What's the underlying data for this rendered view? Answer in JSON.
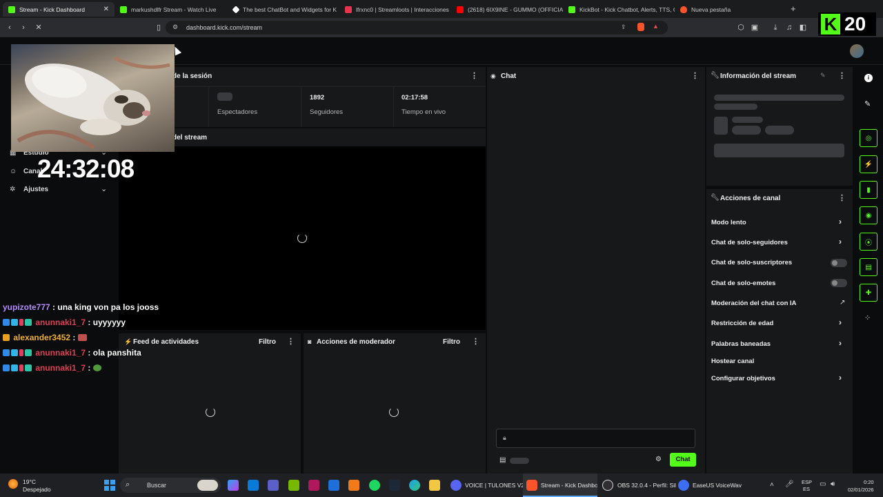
{
  "browser": {
    "tabs": [
      {
        "title": "Stream - Kick Dashboard",
        "color": "#53fc18"
      },
      {
        "title": "markushdlfr Stream - Watch Live",
        "color": "#53fc18"
      },
      {
        "title": "The best ChatBot and Widgets for K",
        "color": "#ffffff"
      },
      {
        "title": "lfrxnc0 | Streamloots | Interacciones",
        "color": "#e8344e"
      },
      {
        "title": "(2618) 6IX9INE - GUMMO (OFFICIAL",
        "color": "#ff0000"
      },
      {
        "title": "KickBot - Kick Chatbot, Alerts, TTS, O",
        "color": "#53fc18"
      },
      {
        "title": "Nueva pestaña",
        "color": "#fb542b"
      }
    ],
    "url": "dashboard.kick.com/stream",
    "new_tab": "+"
  },
  "kick_logo": {
    "letter": "K",
    "number": "20"
  },
  "overlay": {
    "timer": "24:32:08"
  },
  "sidebar": {
    "items": [
      {
        "label": "Estudio",
        "icon": "studio-icon"
      },
      {
        "label": "Canal",
        "icon": "channel-icon"
      },
      {
        "label": "Ajustes",
        "icon": "settings-gear-icon"
      }
    ]
  },
  "session": {
    "title": "de la sesión",
    "stats": [
      {
        "value": "",
        "label": "Espectadores"
      },
      {
        "value": "1892",
        "label": "Seguidores"
      },
      {
        "value": "02:17:58",
        "label": "Tiempo en vivo"
      }
    ]
  },
  "preview": {
    "title": "del stream"
  },
  "activity_feed": {
    "title": "Feed de actividades",
    "filter": "Filtro"
  },
  "mod_actions": {
    "title": "Acciones de moderador",
    "filter": "Filtro"
  },
  "chat": {
    "title": "Chat",
    "send_label": "Chat",
    "accent": "#53fc18"
  },
  "stream_info": {
    "title": "Información del stream"
  },
  "channel_actions": {
    "title": "Acciones de canal",
    "items": [
      {
        "label": "Modo lento",
        "control": "chevron"
      },
      {
        "label": "Chat de solo-seguidores",
        "control": "chevron"
      },
      {
        "label": "Chat de solo-suscriptores",
        "control": "toggle"
      },
      {
        "label": "Chat de solo-emotes",
        "control": "toggle"
      },
      {
        "label": "Moderación del chat con IA",
        "control": "external"
      },
      {
        "label": "Restricción de edad",
        "control": "chevron"
      },
      {
        "label": "Palabras baneadas",
        "control": "chevron"
      },
      {
        "label": "Hostear canal",
        "control": "none"
      },
      {
        "label": "Configurar objetivos",
        "control": "chevron"
      }
    ]
  },
  "chat_overlay": [
    {
      "user": "yupizote777",
      "color": "#b78cff",
      "message": "una king von pa los jooss"
    },
    {
      "user": "anunnaki1_7",
      "color": "#e0405a",
      "message": "uyyyyyy"
    },
    {
      "user": "alexander3452",
      "color": "#f0b232",
      "message": ""
    },
    {
      "user": "anunnaki1_7",
      "color": "#e0405a",
      "message": "ola panshita"
    },
    {
      "user": "anunnaki1_7",
      "color": "#e0405a",
      "message": ""
    }
  ],
  "taskbar": {
    "weather_temp": "19°C",
    "weather_desc": "Despejado",
    "search": "Buscar",
    "apps": [
      {
        "label": "VOICE | TULONES V2"
      },
      {
        "label": "Stream - Kick Dashbc"
      },
      {
        "label": "OBS 32.0.4 - Perfil: Sil"
      },
      {
        "label": "EaseUS VoiceWav"
      }
    ],
    "lang": "ESP",
    "lang2": "ES",
    "time": "0:20",
    "date": "02/01/2026"
  }
}
